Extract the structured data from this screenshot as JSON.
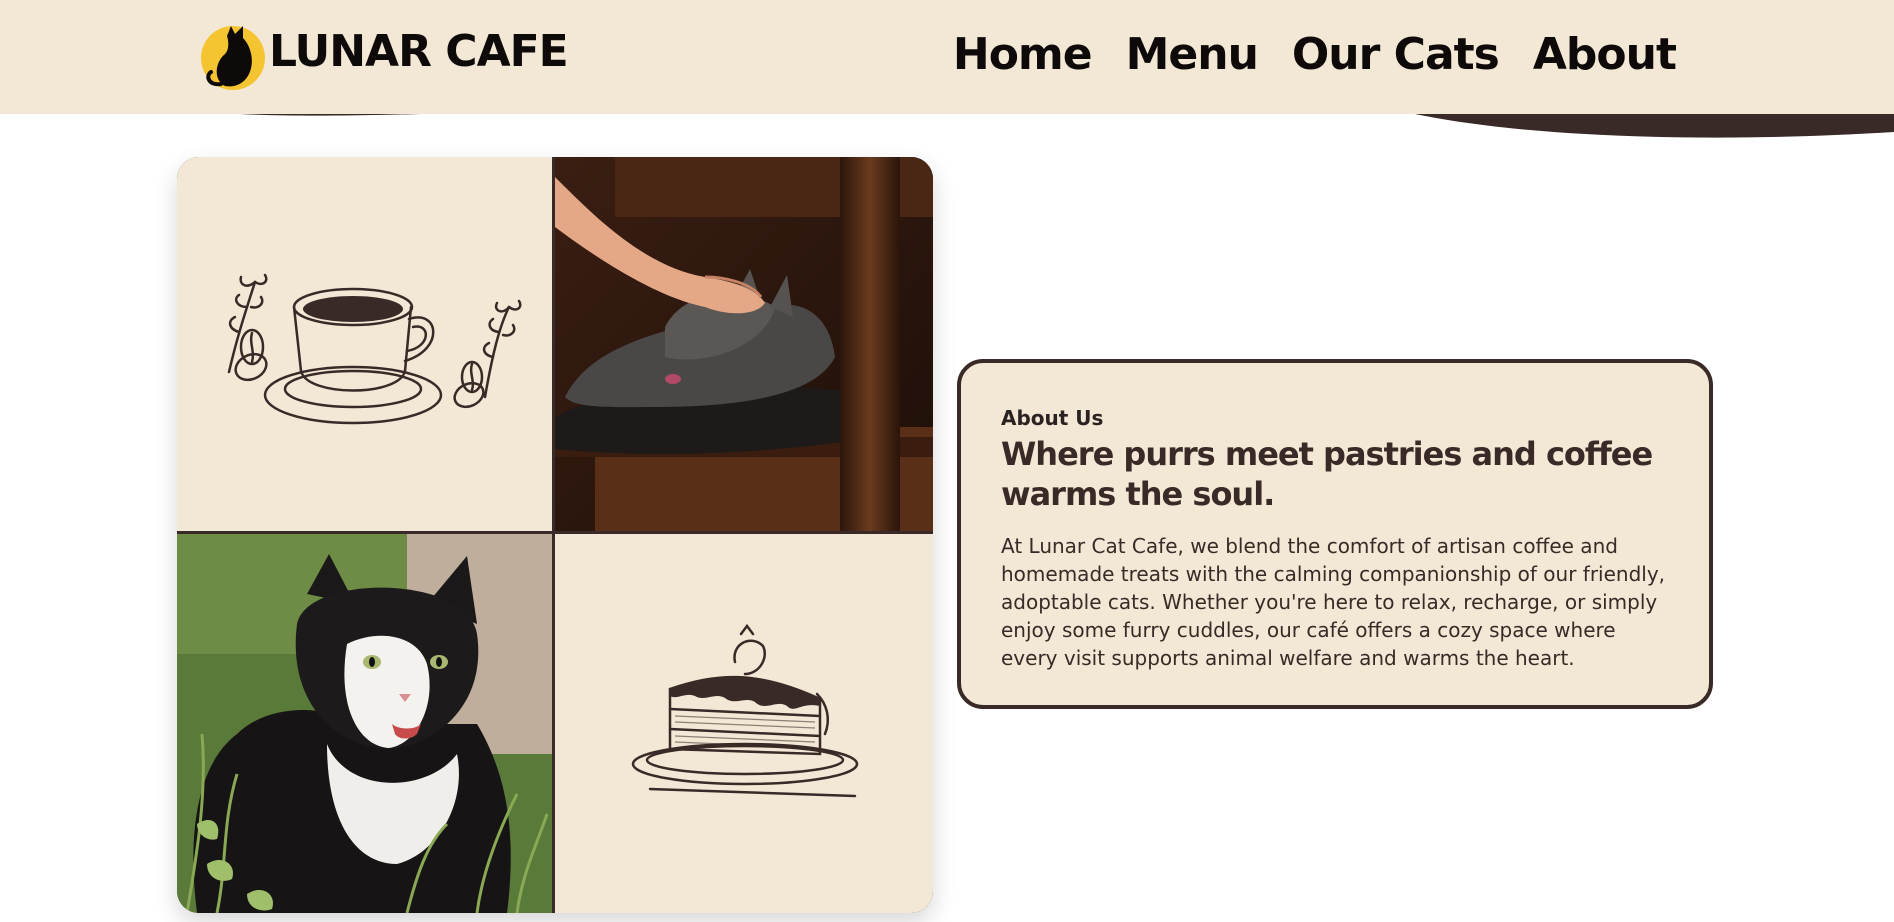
{
  "brand": {
    "name": "LUNAR CAFE",
    "logo_icon": "black-cat-moon-icon"
  },
  "nav": {
    "items": [
      {
        "label": "Home"
      },
      {
        "label": "Menu"
      },
      {
        "label": "Our Cats"
      },
      {
        "label": "About"
      }
    ]
  },
  "gallery": {
    "tiles": [
      {
        "name": "coffee-cup-sketch"
      },
      {
        "name": "petted-gray-cat-photo"
      },
      {
        "name": "tuxedo-cat-in-grass-photo"
      },
      {
        "name": "layer-cake-sketch"
      }
    ]
  },
  "about": {
    "eyebrow": "About Us",
    "headline": "Where purrs meet pastries and coffee warms the soul.",
    "body": "At Lunar Cat Cafe, we blend the comfort of artisan coffee and homemade treats with the calming companionship of our friendly, adoptable cats. Whether you're here to relax, recharge, or simply enjoy some furry cuddles, our café offers a cozy space where every visit supports animal welfare and warms the heart."
  },
  "colors": {
    "cream": "#f2e8d5",
    "dark_brown": "#3a2a27",
    "logo_yellow": "#f5c431",
    "ink": "#0d0a09"
  }
}
